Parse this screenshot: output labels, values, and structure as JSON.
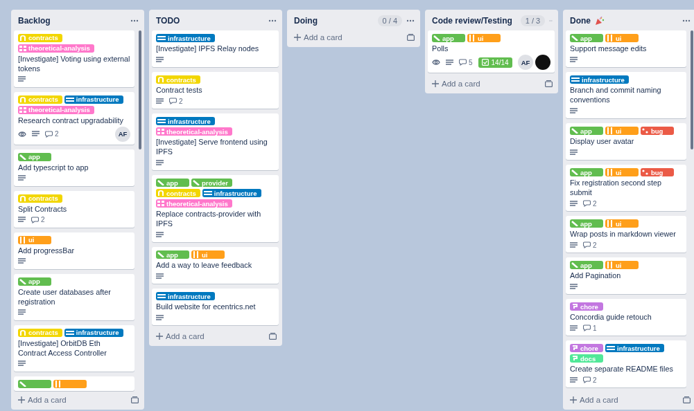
{
  "lists": [
    {
      "title": "Backlog",
      "scrollable": true,
      "footer": "Add a card",
      "cards": [
        {
          "labels": [
            {
              "name": "contracts",
              "color": "#f2d600",
              "kind": "arch"
            },
            {
              "name": "theoretical-analysis",
              "color": "#ff78cb",
              "kind": "grid"
            }
          ],
          "title": "[Investigate] Voting using external tokens",
          "badges": [
            {
              "kind": "description"
            }
          ]
        },
        {
          "labels": [
            {
              "name": "contracts",
              "color": "#f2d600",
              "kind": "arch"
            },
            {
              "name": "infrastructure",
              "color": "#0079bf",
              "kind": "bars"
            },
            {
              "name": "theoretical-analysis",
              "color": "#ff78cb",
              "kind": "grid"
            }
          ],
          "title": "Research contract upgradability",
          "badges": [
            {
              "kind": "watch"
            },
            {
              "kind": "description"
            },
            {
              "kind": "comments",
              "count": "2"
            }
          ],
          "members": [
            {
              "kind": "initials",
              "initials": "AF"
            }
          ]
        },
        {
          "labels": [
            {
              "name": "app",
              "color": "#61bd4f",
              "kind": "slash"
            }
          ],
          "title": "Add typescript to app",
          "badges": [
            {
              "kind": "description"
            }
          ]
        },
        {
          "labels": [
            {
              "name": "contracts",
              "color": "#f2d600",
              "kind": "arch"
            }
          ],
          "title": "Split Contracts",
          "badges": [
            {
              "kind": "description"
            },
            {
              "kind": "comments",
              "count": "2"
            }
          ]
        },
        {
          "labels": [
            {
              "name": "ui",
              "color": "#ff9f1a",
              "kind": "pipes"
            }
          ],
          "title": "Add progressBar",
          "badges": [
            {
              "kind": "description"
            }
          ]
        },
        {
          "labels": [
            {
              "name": "app",
              "color": "#61bd4f",
              "kind": "slash"
            }
          ],
          "title": "Create user databases after registration",
          "badges": [
            {
              "kind": "description"
            }
          ]
        },
        {
          "labels": [
            {
              "name": "contracts",
              "color": "#f2d600",
              "kind": "arch"
            },
            {
              "name": "infrastructure",
              "color": "#0079bf",
              "kind": "bars"
            }
          ],
          "title": "[Investigate] OrbitDB Eth Contract Access Controller",
          "badges": [
            {
              "kind": "description"
            }
          ]
        },
        {
          "labels": [
            {
              "color": "#61bd4f",
              "kind": "slash"
            },
            {
              "color": "#ff9f1a",
              "kind": "pipes"
            }
          ]
        }
      ]
    },
    {
      "title": "TODO",
      "scrollable": false,
      "footer": "Add a card",
      "cards": [
        {
          "labels": [
            {
              "name": "infrastructure",
              "color": "#0079bf",
              "kind": "bars"
            }
          ],
          "title": "[Investigate] IPFS Relay nodes",
          "badges": [
            {
              "kind": "description"
            }
          ]
        },
        {
          "labels": [
            {
              "name": "contracts",
              "color": "#f2d600",
              "kind": "arch"
            }
          ],
          "title": "Contract tests",
          "badges": [
            {
              "kind": "description"
            },
            {
              "kind": "comments",
              "count": "2"
            }
          ]
        },
        {
          "labels": [
            {
              "name": "infrastructure",
              "color": "#0079bf",
              "kind": "bars"
            },
            {
              "name": "theoretical-analysis",
              "color": "#ff78cb",
              "kind": "grid"
            }
          ],
          "title": "[Investigate] Serve frontend using IPFS",
          "badges": [
            {
              "kind": "description"
            }
          ]
        },
        {
          "labels": [
            {
              "name": "app",
              "color": "#61bd4f",
              "kind": "slash"
            },
            {
              "name": "provider",
              "color": "#61bd4f",
              "kind": "slash"
            },
            {
              "name": "contracts",
              "color": "#f2d600",
              "kind": "arch"
            },
            {
              "name": "infrastructure",
              "color": "#0079bf",
              "kind": "bars"
            },
            {
              "name": "theoretical-analysis",
              "color": "#ff78cb",
              "kind": "grid"
            }
          ],
          "title": "Replace contracts-provider with IPFS",
          "badges": [
            {
              "kind": "description"
            }
          ]
        },
        {
          "labels": [
            {
              "name": "app",
              "color": "#61bd4f",
              "kind": "slash"
            },
            {
              "name": "ui",
              "color": "#ff9f1a",
              "kind": "pipes"
            }
          ],
          "title": "Add a way to leave feedback",
          "badges": [
            {
              "kind": "description"
            }
          ]
        },
        {
          "labels": [
            {
              "name": "infrastructure",
              "color": "#0079bf",
              "kind": "bars"
            }
          ],
          "title": "Build website for ecentrics.net",
          "badges": [
            {
              "kind": "description"
            }
          ]
        }
      ]
    },
    {
      "title": "Doing",
      "count": "0 / 4",
      "scrollable": false,
      "footer": "Add a card"
    },
    {
      "title": "Code review/Testing",
      "count": "1 / 3",
      "scrollable": false,
      "footer": "Add a card",
      "cards": [
        {
          "labels": [
            {
              "name": "app",
              "color": "#61bd4f",
              "kind": "slash"
            },
            {
              "name": "ui",
              "color": "#ff9f1a",
              "kind": "pipes"
            }
          ],
          "title": "Polls",
          "badges": [
            {
              "kind": "watch"
            },
            {
              "kind": "description"
            },
            {
              "kind": "comments",
              "count": "5"
            },
            {
              "kind": "checklist",
              "count": "14/14",
              "complete": true
            }
          ],
          "members": [
            {
              "kind": "initials",
              "initials": "AF"
            },
            {
              "kind": "picture"
            }
          ]
        }
      ]
    },
    {
      "title": "Done",
      "party_icon": true,
      "scrollable": true,
      "footer": "Add a card",
      "cards": [
        {
          "labels": [
            {
              "name": "app",
              "color": "#61bd4f",
              "kind": "slash"
            },
            {
              "name": "ui",
              "color": "#ff9f1a",
              "kind": "pipes"
            }
          ],
          "title": "Support message edits",
          "badges": [
            {
              "kind": "description"
            }
          ]
        },
        {
          "labels": [
            {
              "name": "infrastructure",
              "color": "#0079bf",
              "kind": "bars"
            }
          ],
          "title": "Branch and commit naming conventions",
          "badges": [
            {
              "kind": "description"
            }
          ]
        },
        {
          "labels": [
            {
              "name": "app",
              "color": "#61bd4f",
              "kind": "slash"
            },
            {
              "name": "ui",
              "color": "#ff9f1a",
              "kind": "pipes"
            },
            {
              "name": "bug",
              "color": "#eb5a46",
              "kind": "dots"
            }
          ],
          "title": "Display user avatar",
          "badges": [
            {
              "kind": "description"
            }
          ]
        },
        {
          "labels": [
            {
              "name": "app",
              "color": "#61bd4f",
              "kind": "slash"
            },
            {
              "name": "ui",
              "color": "#ff9f1a",
              "kind": "pipes"
            },
            {
              "name": "bug",
              "color": "#eb5a46",
              "kind": "dots"
            }
          ],
          "title": "Fix registration second step submit",
          "badges": [
            {
              "kind": "description"
            },
            {
              "kind": "comments",
              "count": "2"
            }
          ]
        },
        {
          "labels": [
            {
              "name": "app",
              "color": "#61bd4f",
              "kind": "slash"
            },
            {
              "name": "ui",
              "color": "#ff9f1a",
              "kind": "pipes"
            }
          ],
          "title": "Wrap posts in markdown viewer",
          "badges": [
            {
              "kind": "description"
            },
            {
              "kind": "comments",
              "count": "2"
            }
          ]
        },
        {
          "labels": [
            {
              "name": "app",
              "color": "#61bd4f",
              "kind": "slash"
            },
            {
              "name": "ui",
              "color": "#ff9f1a",
              "kind": "pipes"
            }
          ],
          "title": "Add Pagination",
          "badges": [
            {
              "kind": "description"
            }
          ]
        },
        {
          "labels": [
            {
              "name": "chore",
              "color": "#c377e0",
              "kind": "hook"
            }
          ],
          "title": "Concordia guide retouch",
          "badges": [
            {
              "kind": "description"
            },
            {
              "kind": "comments",
              "count": "1"
            }
          ]
        },
        {
          "labels": [
            {
              "name": "chore",
              "color": "#c377e0",
              "kind": "hook"
            },
            {
              "name": "infrastructure",
              "color": "#0079bf",
              "kind": "bars"
            },
            {
              "name": "docs",
              "color": "#51e898",
              "kind": "hook"
            }
          ],
          "title": "Create separate README files",
          "badges": [
            {
              "kind": "description"
            },
            {
              "kind": "comments",
              "count": "2"
            }
          ]
        }
      ]
    }
  ]
}
